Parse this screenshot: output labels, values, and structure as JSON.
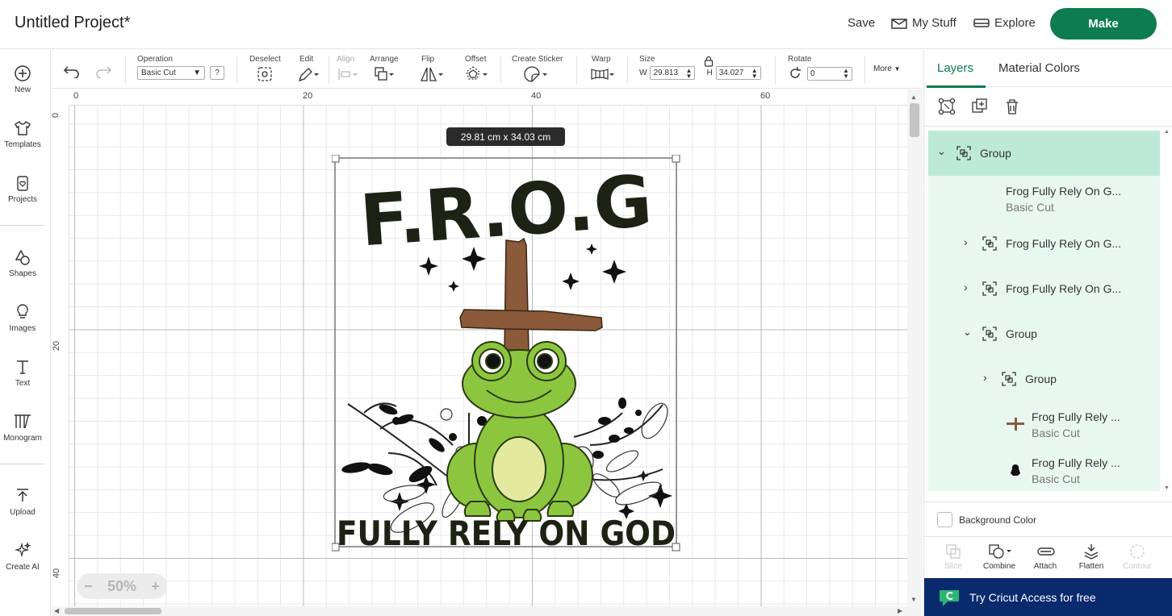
{
  "header": {
    "project_title": "Untitled Project*",
    "save_label": "Save",
    "my_stuff_label": "My Stuff",
    "explore_label": "Explore",
    "make_label": "Make"
  },
  "sidebar": {
    "items": [
      {
        "label": "New",
        "icon": "plus-circle-icon"
      },
      {
        "label": "Templates",
        "icon": "shirt-icon"
      },
      {
        "label": "Projects",
        "icon": "clipboard-heart-icon"
      },
      {
        "label": "Shapes",
        "icon": "shapes-icon"
      },
      {
        "label": "Images",
        "icon": "lightbulb-icon"
      },
      {
        "label": "Text",
        "icon": "text-icon"
      },
      {
        "label": "Monogram",
        "icon": "monogram-icon"
      },
      {
        "label": "Upload",
        "icon": "upload-icon"
      },
      {
        "label": "Create AI",
        "icon": "sparkle-icon"
      }
    ]
  },
  "toolbar": {
    "operation_label": "Operation",
    "operation_value": "Basic Cut",
    "help_label": "?",
    "deselect_label": "Deselect",
    "edit_label": "Edit",
    "align_label": "Align",
    "arrange_label": "Arrange",
    "flip_label": "Flip",
    "offset_label": "Offset",
    "create_sticker_label": "Create Sticker",
    "warp_label": "Warp",
    "size_label": "Size",
    "width_prefix": "W",
    "width_value": "29.813",
    "height_prefix": "H",
    "height_value": "34.027",
    "rotate_label": "Rotate",
    "rotate_value": "0",
    "more_label": "More"
  },
  "canvas": {
    "ruler_top": [
      "0",
      "20",
      "40",
      "60"
    ],
    "ruler_left": [
      "0",
      "20",
      "40"
    ],
    "size_tooltip": "29.81  cm x 34.03  cm",
    "zoom_minus": "−",
    "zoom_value": "50%",
    "zoom_plus": "+"
  },
  "design": {
    "title_text": "F.R.O.G",
    "bottom_text": "FULLY RELY ON GOD",
    "colors": {
      "text_dark": "#1d2214",
      "cross_brown": "#8a5a3a",
      "frog_green": "#8cc63f",
      "frog_dark": "#4f8a1f",
      "belly": "#e3eaa0"
    }
  },
  "right_panel": {
    "tabs": [
      "Layers",
      "Material Colors"
    ],
    "layers": [
      {
        "name": "Group",
        "sub": ""
      },
      {
        "name": "Frog Fully Rely On G...",
        "sub": "Basic Cut"
      },
      {
        "name": "Frog Fully Rely On G...",
        "sub": ""
      },
      {
        "name": "Frog Fully Rely On G...",
        "sub": ""
      },
      {
        "name": "Group",
        "sub": ""
      },
      {
        "name": "Group",
        "sub": ""
      },
      {
        "name": "Frog Fully Rely ...",
        "sub": "Basic Cut"
      },
      {
        "name": "Frog Fully Rely ...",
        "sub": "Basic Cut"
      }
    ],
    "background_color_label": "Background Color",
    "bottom_tools": [
      "Slice",
      "Combine",
      "Attach",
      "Flatten",
      "Contour"
    ],
    "banner_label": "Try Cricut Access for free"
  },
  "colors": {
    "accent": "#0d7c4f",
    "layer_selected": "#bde9d9",
    "layer_bg": "#e9f7f1",
    "banner": "#0a2a6e"
  }
}
